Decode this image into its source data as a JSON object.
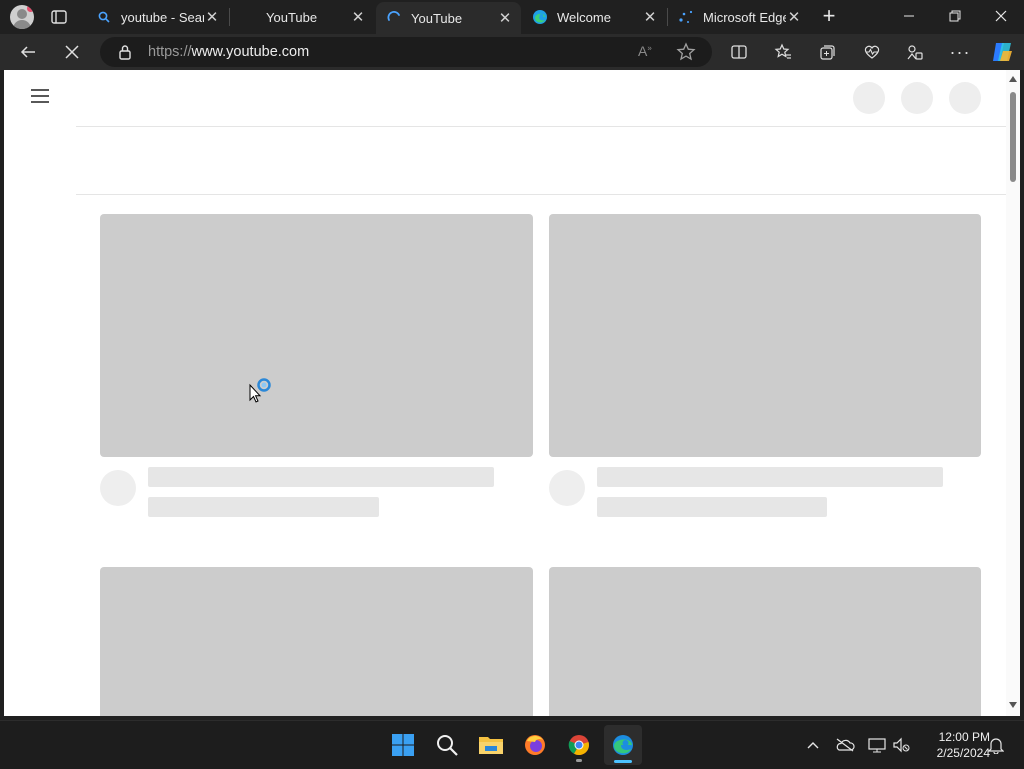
{
  "browser": {
    "tabs": [
      {
        "title": "youtube - Search",
        "favicon": "search-icon",
        "active": false
      },
      {
        "title": "YouTube",
        "favicon": "none",
        "active": false
      },
      {
        "title": "YouTube",
        "favicon": "loading-spinner-icon",
        "active": true
      },
      {
        "title": "Welcome",
        "favicon": "edge-logo-icon",
        "active": false
      },
      {
        "title": "Microsoft Edge",
        "favicon": "edge-loading-icon",
        "active": false
      }
    ],
    "address": {
      "scheme": "https://",
      "host": "www.youtube.com"
    }
  },
  "page": {
    "state": "loading skeleton"
  },
  "taskbar": {
    "time": "12:00 PM",
    "date": "2/25/2024",
    "apps": [
      "start-icon",
      "search-icon",
      "file-explorer-icon",
      "firefox-icon",
      "chrome-icon",
      "edge-icon"
    ]
  },
  "colors": {
    "skeleton": "#cccccc",
    "skeleton_light": "#e6e6e6",
    "edge_accent": "#0a84ff"
  }
}
